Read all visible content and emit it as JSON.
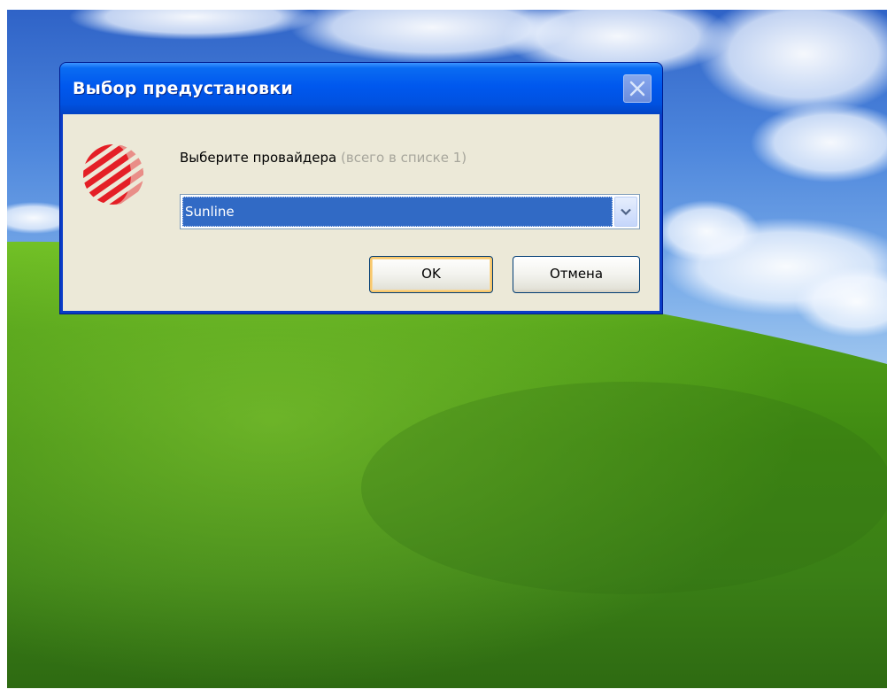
{
  "dialog": {
    "title": "Выбор предустановки",
    "close_icon": "close-icon",
    "logo_icon": "provider-logo-icon",
    "prompt_label": "Выберите провайдера",
    "prompt_hint": "(всего в списке 1)",
    "provider_select": {
      "selected_value": "Sunline",
      "arrow_icon": "chevron-down-icon"
    },
    "ok_label": "OK",
    "cancel_label": "Отмена"
  },
  "colors": {
    "titlebar": "#0058ee",
    "client_background": "#ece9d8",
    "selection": "#316ac5",
    "hint_text": "#a7a69c",
    "logo_red": "#e41f26"
  }
}
